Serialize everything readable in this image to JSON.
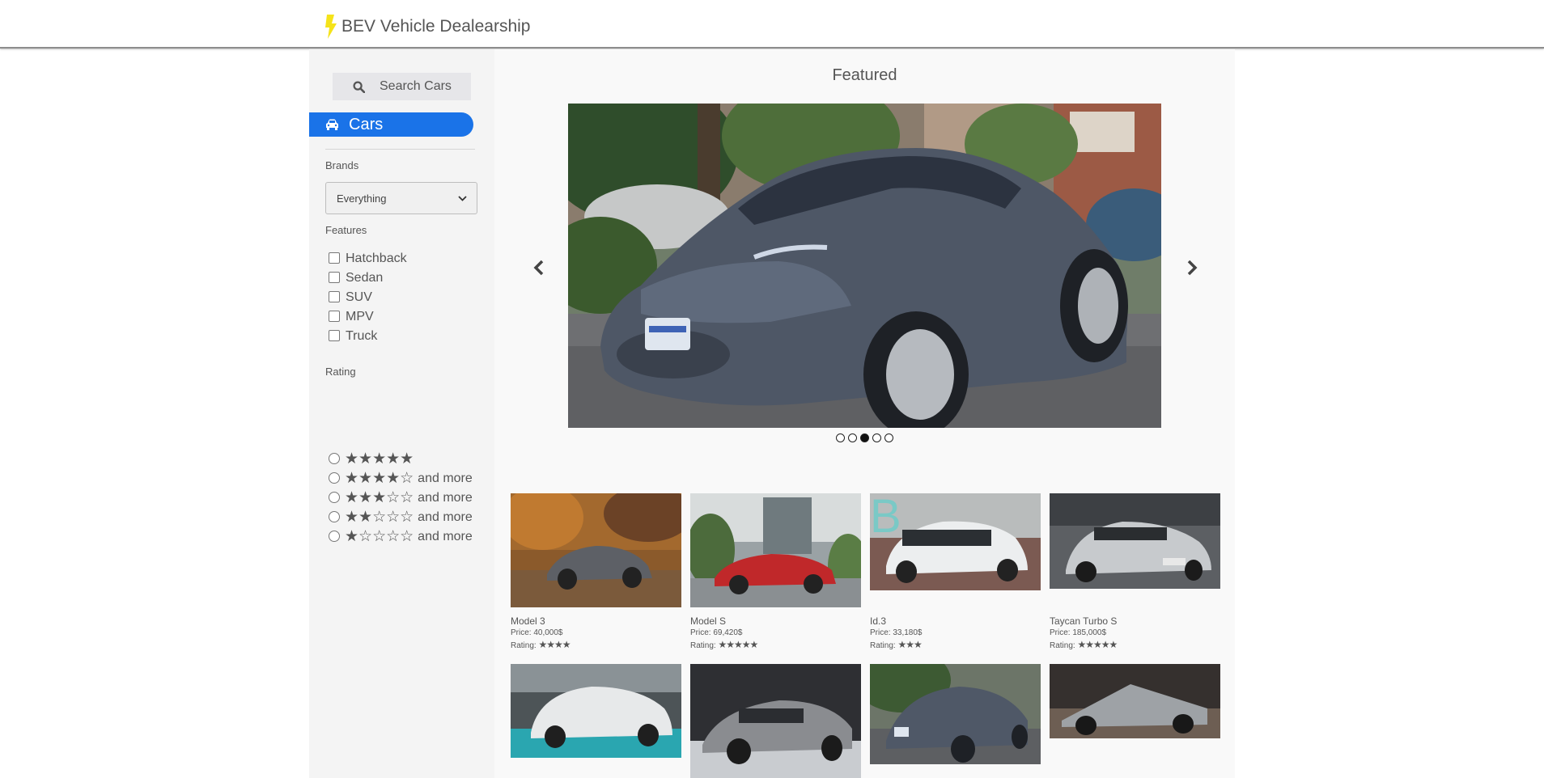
{
  "header": {
    "title": "BEV Vehicle Dealearship",
    "logo_icon": "lightning-bolt-icon",
    "logo_color": "#f5e31a"
  },
  "sidebar": {
    "search_label": "Search Cars",
    "nav": [
      {
        "label": "Cars",
        "icon": "car-icon",
        "active": true,
        "color": "#1a73e8"
      }
    ],
    "brands_label": "Brands",
    "brands_selected": "Everything",
    "features_label": "Features",
    "features": [
      "Hatchback",
      "Sedan",
      "SUV",
      "MPV",
      "Truck"
    ],
    "rating_label": "Rating",
    "rating_options": [
      {
        "stars": "★★★★★",
        "suffix": ""
      },
      {
        "stars": "★★★★☆",
        "suffix": "and more"
      },
      {
        "stars": "★★★☆☆",
        "suffix": "and more"
      },
      {
        "stars": "★★☆☆☆",
        "suffix": "and more"
      },
      {
        "stars": "★☆☆☆☆",
        "suffix": "and more"
      }
    ]
  },
  "main": {
    "featured_title": "Featured",
    "carousel": {
      "slides": 5,
      "active_index": 2
    },
    "cars": [
      {
        "name": "Model 3",
        "price": "Price: 40,000$",
        "rating_label": "Rating:",
        "stars": "★★★★",
        "rating": 4
      },
      {
        "name": "Model S",
        "price": "Price: 69,420$",
        "rating_label": "Rating:",
        "stars": "★★★★★",
        "rating": 5
      },
      {
        "name": "Id.3",
        "price": "Price: 33,180$",
        "rating_label": "Rating:",
        "stars": "★★★",
        "rating": 3
      },
      {
        "name": "Taycan Turbo S",
        "price": "Price: 185,000$",
        "rating_label": "Rating:",
        "stars": "★★★★★",
        "rating": 5
      },
      {
        "name": "",
        "price": "",
        "rating_label": "",
        "stars": ""
      },
      {
        "name": "",
        "price": "",
        "rating_label": "",
        "stars": ""
      },
      {
        "name": "",
        "price": "",
        "rating_label": "",
        "stars": ""
      },
      {
        "name": "",
        "price": "",
        "rating_label": "",
        "stars": ""
      }
    ]
  }
}
